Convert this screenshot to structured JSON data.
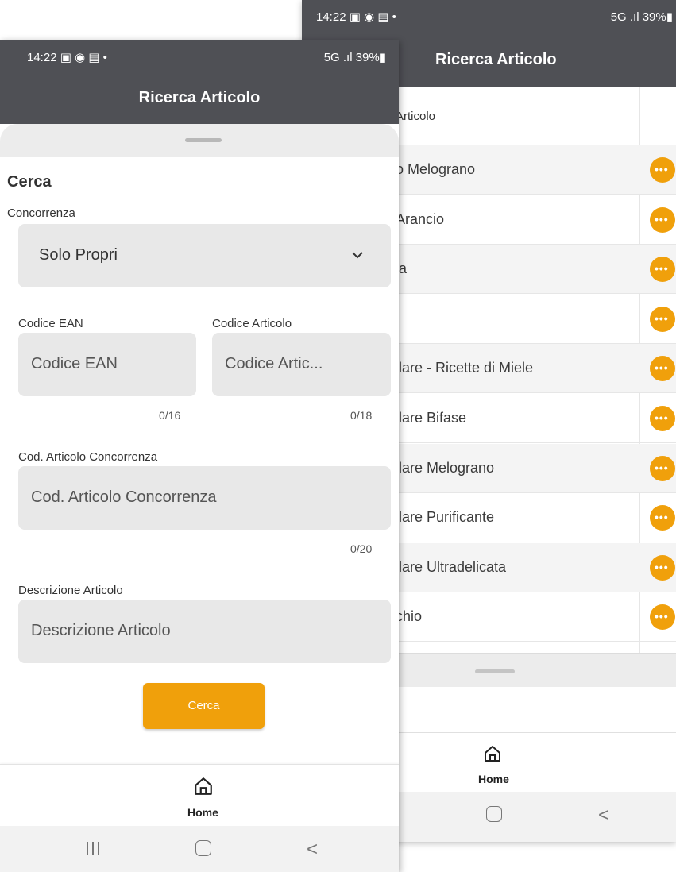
{
  "back_screen": {
    "status": {
      "time": "14:22 ▣ ◉ ▤ •",
      "indicators": "5G .ıl 39%▮"
    },
    "title": "Ricerca Articolo",
    "table_header": "Articolo",
    "rows": [
      "o Melograno",
      " Arancio",
      "ia",
      "",
      "llare - Ricette di Miele",
      "llare Bifase",
      "llare Melograno",
      "llare Purificante",
      "llare Ultradelicata",
      "chio"
    ],
    "row_action": "•••",
    "nav": {
      "home": "Home"
    },
    "sys_back": "<"
  },
  "front_screen": {
    "status": {
      "time": "14:22 ▣ ◉ ▤ •",
      "indicators": "5G .ıl 39%▮"
    },
    "title": "Ricerca Articolo",
    "form": {
      "heading": "Cerca",
      "concorrenza": {
        "label": "Concorrenza",
        "value": "Solo Propri"
      },
      "ean": {
        "label": "Codice EAN",
        "placeholder": "Codice EAN",
        "counter": "0/16"
      },
      "cod_articolo": {
        "label": "Codice Articolo",
        "placeholder": "Codice Artic...",
        "counter": "0/18"
      },
      "cod_concorrenza": {
        "label": "Cod. Articolo Concorrenza",
        "placeholder": "Cod. Articolo Concorrenza",
        "counter": "0/20"
      },
      "descrizione": {
        "label": "Descrizione Articolo",
        "placeholder": "Descrizione Articolo"
      },
      "submit": "Cerca"
    },
    "nav": {
      "home": "Home"
    },
    "sys_back": "<"
  },
  "colors": {
    "appbar": "#4f5055",
    "accent": "#f0a00b",
    "field": "#e8e8e8"
  }
}
